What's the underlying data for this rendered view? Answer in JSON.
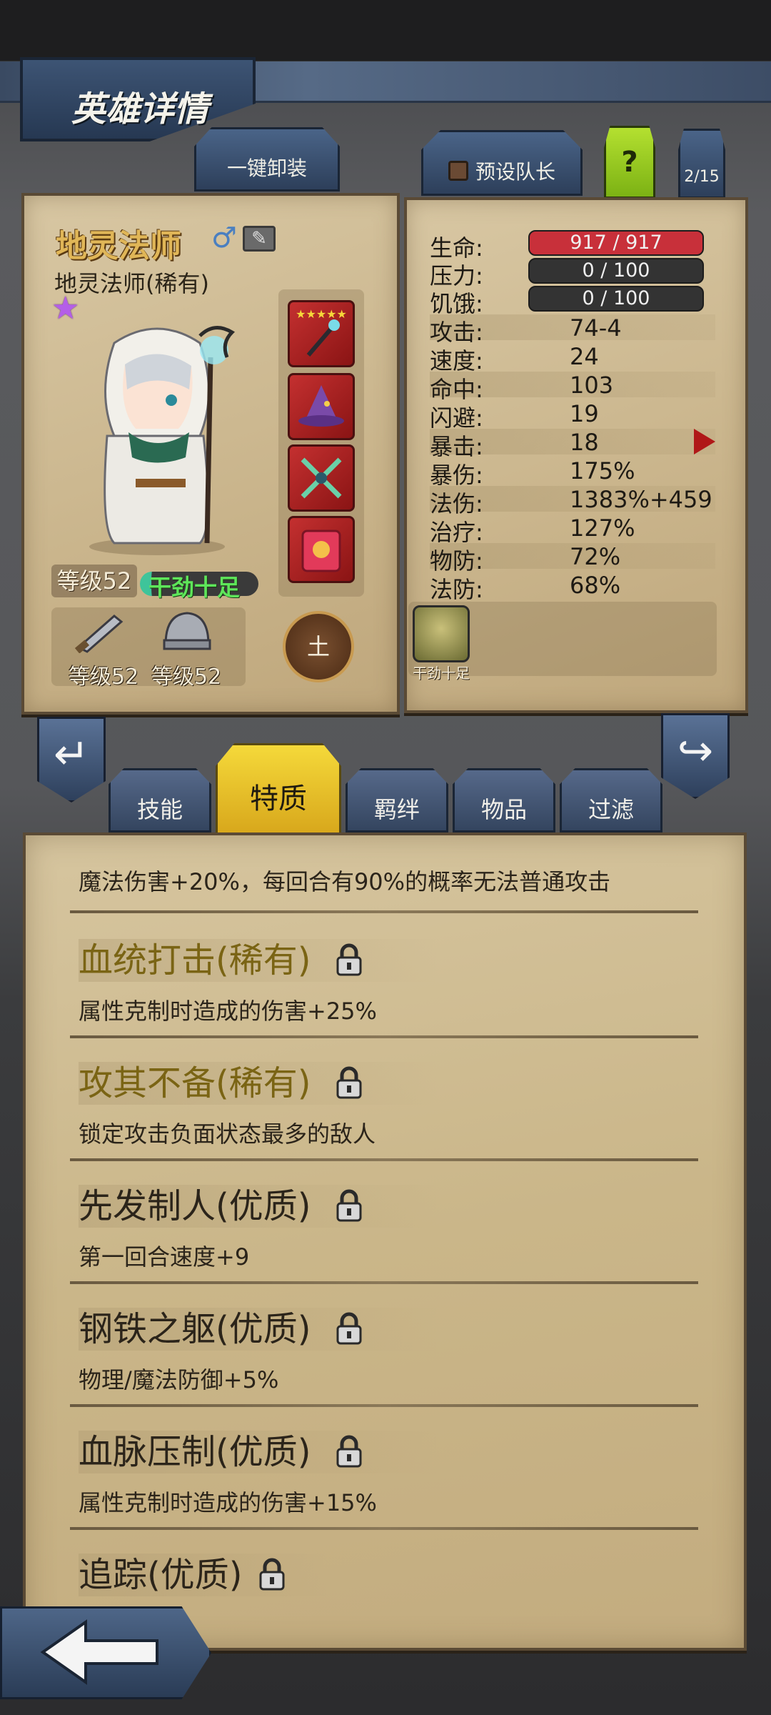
{
  "header": {
    "title": "英雄详情",
    "unequip_all": "一键卸装",
    "preset_captain": "预设队长",
    "help": "?",
    "page_counter": "2/15"
  },
  "hero": {
    "name": "地灵法师",
    "gender_icon": "male-icon",
    "subname": "地灵法师(稀有)",
    "star_color": "#b45ee8",
    "level": "等级52",
    "mood": "干劲十足",
    "weapon_level": "等级52",
    "armor_level": "等级52",
    "element": "土",
    "equipment_rating": "★★★★★",
    "equipment": [
      "staff-icon",
      "wizard-hat-icon",
      "crossed-daggers-icon",
      "spellbook-icon"
    ]
  },
  "stats": {
    "bars": [
      {
        "label": "生命:",
        "value": "917 / 917",
        "fill": 1.0
      },
      {
        "label": "压力:",
        "value": "0 / 100",
        "fill": 0.0
      },
      {
        "label": "饥饿:",
        "value": "0 / 100",
        "fill": 0.0
      }
    ],
    "rows": [
      {
        "label": "攻击:",
        "value": "74-4"
      },
      {
        "label": "速度:",
        "value": "24"
      },
      {
        "label": "命中:",
        "value": "103"
      },
      {
        "label": "闪避:",
        "value": "19"
      },
      {
        "label": "暴击:",
        "value": "18"
      },
      {
        "label": "暴伤:",
        "value": "175%"
      },
      {
        "label": "法伤:",
        "value": "1383%+459"
      },
      {
        "label": "治疗:",
        "value": "127%"
      },
      {
        "label": "物防:",
        "value": "72%"
      },
      {
        "label": "法防:",
        "value": "68%"
      }
    ],
    "status_icon_label": "干劲十足"
  },
  "tabs": [
    {
      "label": "技能",
      "active": false
    },
    {
      "label": "特质",
      "active": true
    },
    {
      "label": "羁绊",
      "active": false
    },
    {
      "label": "物品",
      "active": false
    },
    {
      "label": "过滤",
      "active": false
    }
  ],
  "traits": [
    {
      "title": "",
      "desc": "魔法伤害+20%，每回合有90%的概率无法普通攻击",
      "rarity": "rare"
    },
    {
      "title": "血统打击(稀有)",
      "desc": "属性克制时造成的伤害+25%",
      "rarity": "rare"
    },
    {
      "title": "攻其不备(稀有)",
      "desc": "锁定攻击负面状态最多的敌人",
      "rarity": "rare"
    },
    {
      "title": "先发制人(优质)",
      "desc": "第一回合速度+9",
      "rarity": "good"
    },
    {
      "title": "钢铁之躯(优质)",
      "desc": "物理/魔法防御+5%",
      "rarity": "good"
    },
    {
      "title": "血脉压制(优质)",
      "desc": "属性克制时造成的伤害+15%",
      "rarity": "good"
    },
    {
      "title": "追踪(优质)",
      "desc": "",
      "rarity": "good"
    }
  ],
  "colors": {
    "rare_title": "#7a6414",
    "good_title": "#2b241a",
    "hp_bar": "#c8303a",
    "active_tab": "#f5d93a",
    "help_button": "#9ed21e"
  }
}
